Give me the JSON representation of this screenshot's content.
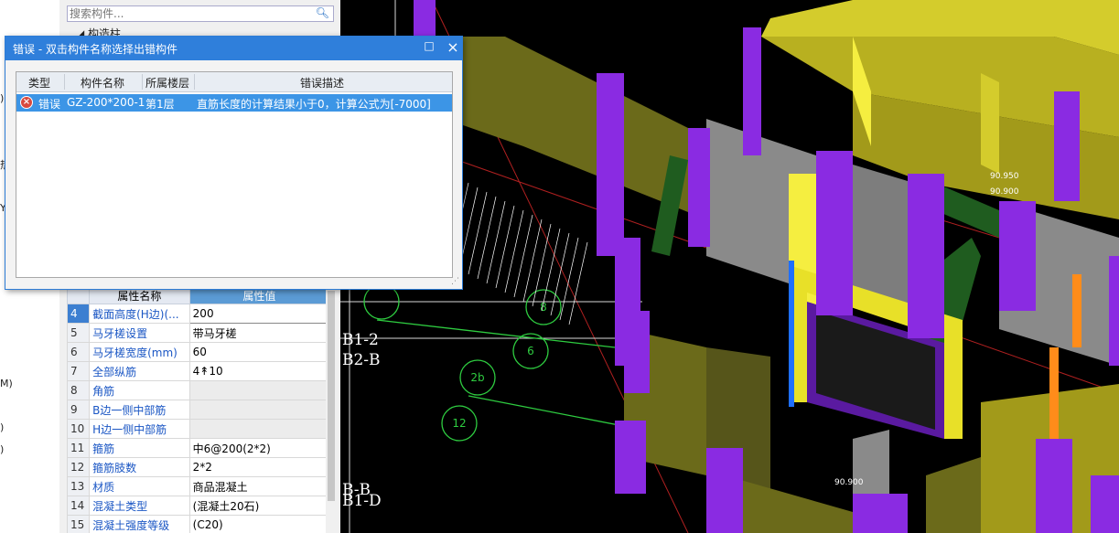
{
  "left_strip": {
    "fragments": [
      ")",
      "热",
      "Y",
      "M)",
      ")",
      ")"
    ]
  },
  "panel": {
    "search_placeholder": "搜索构件...",
    "tree_item": "◢ 构造柱",
    "table": {
      "headers": [
        "属性名称",
        "属性值"
      ],
      "rows": [
        {
          "num": "4",
          "name": "截面高度(H边)(...",
          "value": "200"
        },
        {
          "num": "5",
          "name": "马牙槎设置",
          "value": "带马牙槎"
        },
        {
          "num": "6",
          "name": "马牙槎宽度(mm)",
          "value": "60"
        },
        {
          "num": "7",
          "name": "全部纵筋",
          "value": "4↟10"
        },
        {
          "num": "8",
          "name": "角筋",
          "value": ""
        },
        {
          "num": "9",
          "name": "B边一侧中部筋",
          "value": ""
        },
        {
          "num": "10",
          "name": "H边一侧中部筋",
          "value": ""
        },
        {
          "num": "11",
          "name": "箍筋",
          "value": "中6@200(2*2)"
        },
        {
          "num": "12",
          "name": "箍筋肢数",
          "value": "2*2"
        },
        {
          "num": "13",
          "name": "材质",
          "value": "商品混凝土"
        },
        {
          "num": "14",
          "name": "混凝土类型",
          "value": "(混凝土20石)"
        },
        {
          "num": "15",
          "name": "混凝土强度等级",
          "value": "(C20)"
        }
      ]
    }
  },
  "viewport": {
    "labels": [
      "B1-2",
      "B2-B",
      "B-B",
      "B1-D"
    ]
  },
  "dialog": {
    "title": "错误 - 双击构件名称选择出错构件",
    "maximize_glyph": "□",
    "close_glyph": "×",
    "columns": [
      "类型",
      "构件名称",
      "所属楼层",
      "错误描述"
    ],
    "rows": [
      {
        "type": "错误",
        "component": "GZ-200*200-1",
        "floor": "第1层",
        "description": "直筋长度的计算结果小于0，计算公式为[-7000]"
      }
    ]
  },
  "colors": {
    "wall_yellow": "#d4cc2c",
    "wall_olive": "#6b6a1a",
    "column_purple": "#8a2be2",
    "beam_green": "#1f5c1f",
    "title_blue": "#2f7fdb"
  }
}
